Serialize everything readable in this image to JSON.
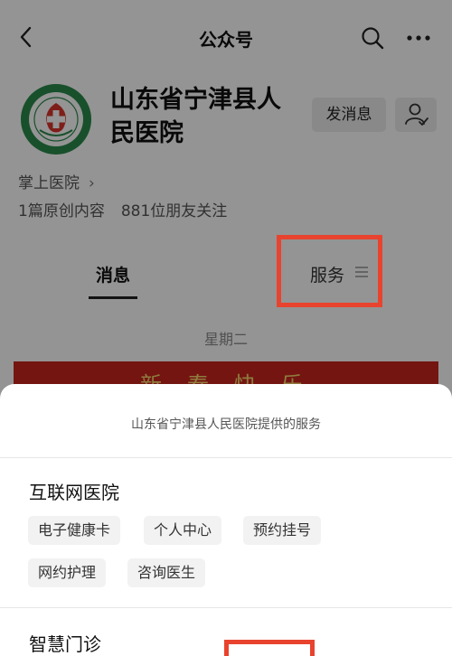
{
  "navbar": {
    "title": "公众号"
  },
  "profile": {
    "name": "山东省宁津县人民医院",
    "send_message": "发消息",
    "quick_link": "掌上医院",
    "stats": {
      "original": "1篇原创内容",
      "followers": "881位朋友关注"
    }
  },
  "tabs": {
    "messages": "消息",
    "service": "服务"
  },
  "feed": {
    "date": "星期二",
    "banner": "新春快乐"
  },
  "colors": {
    "highlight": "#e8432e",
    "banner": "#c9251e",
    "logo_green": "#2a8a4a"
  },
  "sheet": {
    "title": "山东省宁津县人民医院提供的服务",
    "sections": [
      {
        "title": "互联网医院",
        "items": [
          "电子健康卡",
          "个人中心",
          "预约挂号",
          "网约护理",
          "咨询医生"
        ]
      },
      {
        "title": "智慧门诊"
      }
    ]
  }
}
